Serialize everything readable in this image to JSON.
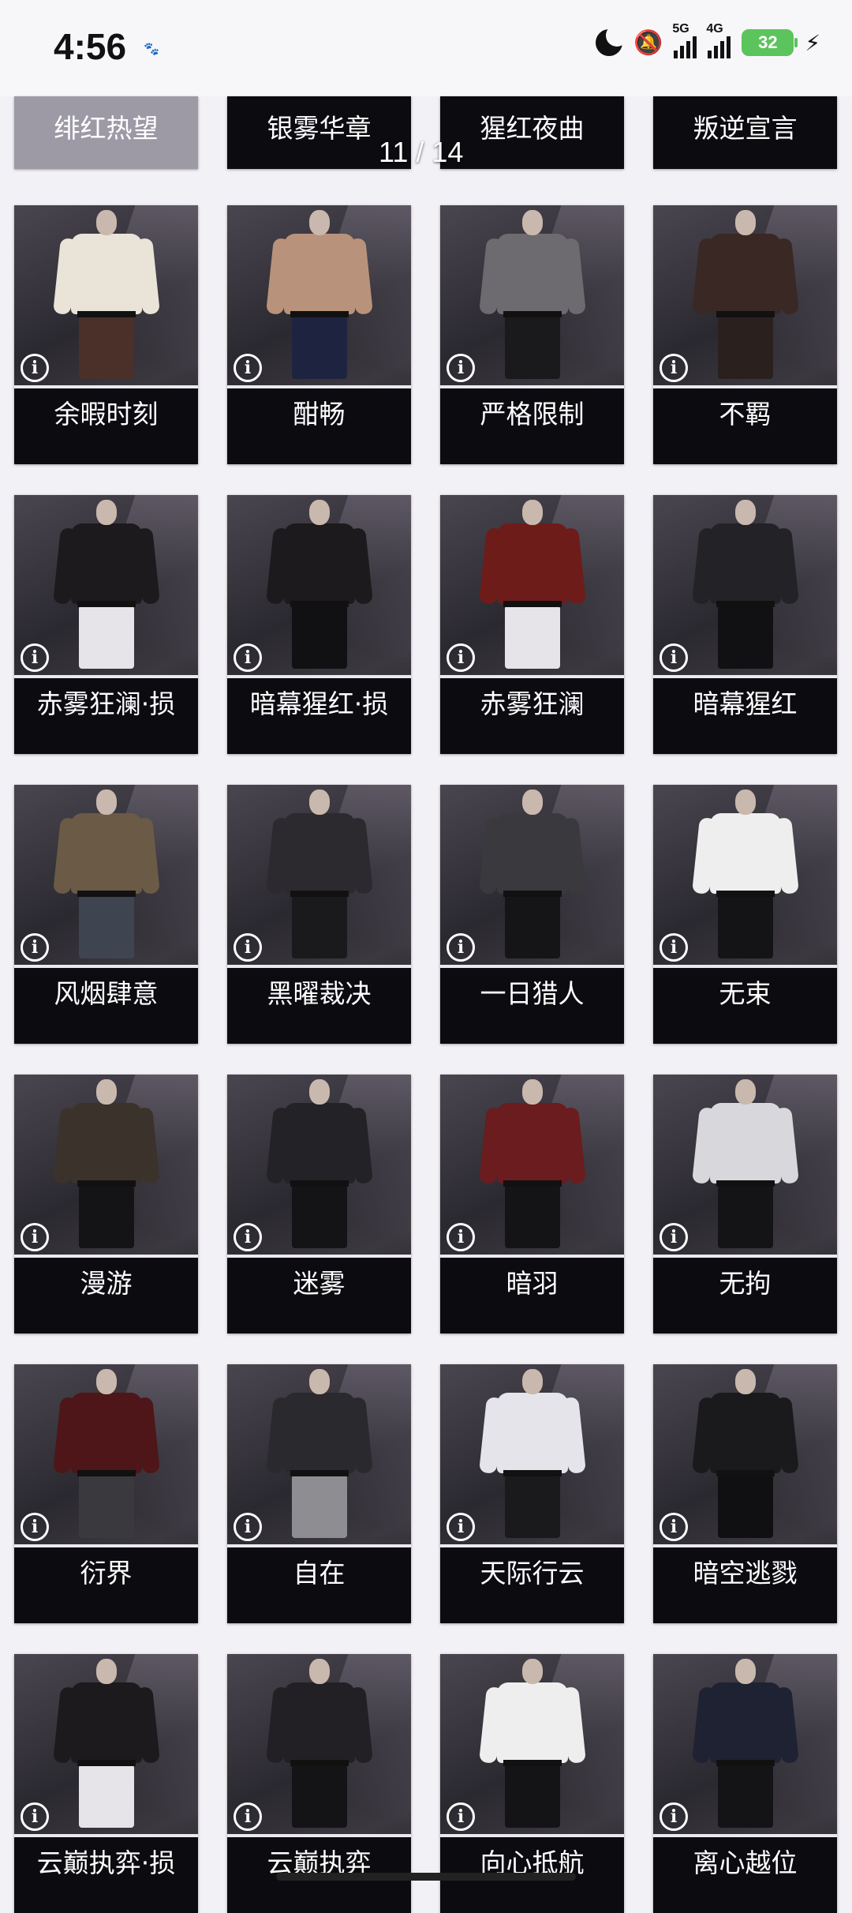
{
  "status": {
    "time": "4:56",
    "small_icon": "🐾",
    "signal_5g": "5G",
    "signal_4g": "4G",
    "battery": "32"
  },
  "pager": {
    "text": "11 / 14"
  },
  "top_row": [
    "绯红热望",
    "银雾华章",
    "猩红夜曲",
    "叛逆宣言"
  ],
  "rows": [
    [
      {
        "name": "余暇时刻",
        "top": "#e9e3d8",
        "arms": "#e9e3d8",
        "legs": "#4a3028"
      },
      {
        "name": "酣畅",
        "top": "#b9927c",
        "arms": "#b9927c",
        "legs": "#1e2440"
      },
      {
        "name": "严格限制",
        "top": "#6d6a70",
        "arms": "#6d6a70",
        "legs": "#1a1a1c"
      },
      {
        "name": "不羁",
        "top": "#3a2824",
        "arms": "#3a2824",
        "legs": "#2a201e"
      }
    ],
    [
      {
        "name": "赤雾狂澜·损",
        "top": "#1c1a1c",
        "arms": "#1c1a1c",
        "legs": "#e6e4e8"
      },
      {
        "name": "暗幕猩红·损",
        "top": "#1c1a1c",
        "arms": "#1c1a1c",
        "legs": "#111113"
      },
      {
        "name": "赤雾狂澜",
        "top": "#6e1c1a",
        "arms": "#6e1c1a",
        "legs": "#e6e4e8"
      },
      {
        "name": "暗幕猩红",
        "top": "#232226",
        "arms": "#232226",
        "legs": "#111113"
      }
    ],
    [
      {
        "name": "风烟肆意",
        "top": "#6b5a46",
        "arms": "#6b5a46",
        "legs": "#3f4550"
      },
      {
        "name": "黑曜裁决",
        "top": "#2c2a2e",
        "arms": "#2c2a2e",
        "legs": "#1a1a1c"
      },
      {
        "name": "一日猎人",
        "top": "#3a3a3e",
        "arms": "#3a3a3e",
        "legs": "#151517"
      },
      {
        "name": "无束",
        "top": "#eeeeee",
        "arms": "#eeeeee",
        "legs": "#141416"
      }
    ],
    [
      {
        "name": "漫游",
        "top": "#3c322c",
        "arms": "#3c322c",
        "legs": "#141416"
      },
      {
        "name": "迷雾",
        "top": "#232226",
        "arms": "#232226",
        "legs": "#141416"
      },
      {
        "name": "暗羽",
        "top": "#6a1c1e",
        "arms": "#6a1c1e",
        "legs": "#141416"
      },
      {
        "name": "无拘",
        "top": "#d8d8dc",
        "arms": "#d8d8dc",
        "legs": "#141416"
      }
    ],
    [
      {
        "name": "衍界",
        "top": "#4e1618",
        "arms": "#4e1618",
        "legs": "#3a3a3e"
      },
      {
        "name": "自在",
        "top": "#2a2a2e",
        "arms": "#2a2a2e",
        "legs": "#8e8e92"
      },
      {
        "name": "天际行云",
        "top": "#e4e4ea",
        "arms": "#e4e4ea",
        "legs": "#1a1a1c"
      },
      {
        "name": "暗空逃戮",
        "top": "#1a1a1c",
        "arms": "#1a1a1c",
        "legs": "#101012"
      }
    ],
    [
      {
        "name": "云巅执弈·损",
        "top": "#1c1a1c",
        "arms": "#1c1a1c",
        "legs": "#e6e4e8"
      },
      {
        "name": "云巅执弈",
        "top": "#222024",
        "arms": "#222024",
        "legs": "#141416"
      },
      {
        "name": "向心抵航",
        "top": "#eeeeee",
        "arms": "#eeeeee",
        "legs": "#141416"
      },
      {
        "name": "离心越位",
        "top": "#1e2232",
        "arms": "#1e2232",
        "legs": "#141416"
      }
    ]
  ]
}
